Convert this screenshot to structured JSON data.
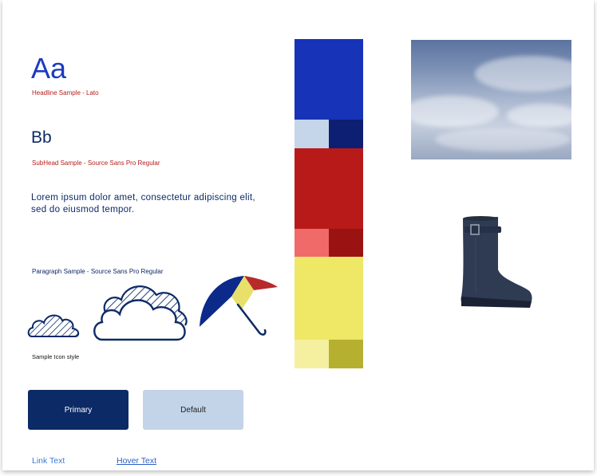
{
  "typography": {
    "headline_sample": "Aa",
    "headline_caption": "Headline Sample - Lato",
    "subhead_sample": "Bb",
    "subhead_caption": "SubHead Sample - Source Sans Pro Regular",
    "paragraph_text": "Lorem ipsum dolor amet, consectetur adipiscing elit, sed do eiusmod tempor.",
    "paragraph_caption": "Paragraph Sample - Source Sans Pro Regular"
  },
  "icons": {
    "caption": "Sample Icon style",
    "items": [
      "cloud-small-icon",
      "cloud-large-icon",
      "umbrella-icon"
    ]
  },
  "buttons": {
    "primary_label": "Primary",
    "default_label": "Default"
  },
  "links": {
    "link_text": "Link Text",
    "hover_text": "Hover Text"
  },
  "palette": {
    "blue": "#1733b8",
    "blue_light": "#c5d5ea",
    "blue_dark": "#0c1f72",
    "red": "#b81a1a",
    "red_light": "#f06a6a",
    "red_dark": "#9b1212",
    "yellow": "#eee866",
    "yellow_light": "#f4f0a0",
    "yellow_dark": "#b5b030"
  },
  "images": [
    "sky-photo",
    "rain-boot-photo"
  ]
}
